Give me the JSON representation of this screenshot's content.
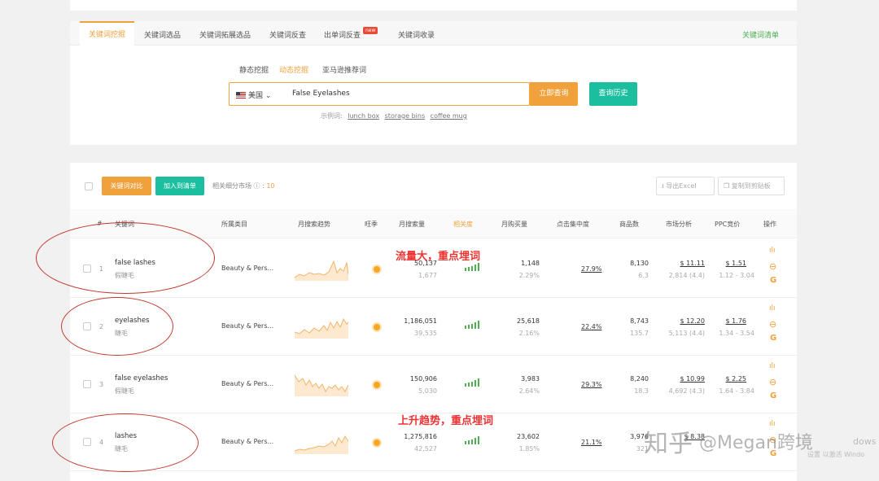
{
  "tabs": [
    "关键词挖掘",
    "关键词选品",
    "关键词拓展选品",
    "关键词反查",
    "出单词反查",
    "关键词收录"
  ],
  "tab_new_badge": "new",
  "tab_right": "关键词清单",
  "subtabs": [
    "静态挖掘",
    "动态挖掘",
    "亚马逊推荐词"
  ],
  "search": {
    "country": "美国",
    "value": "False Eyelashes",
    "query_btn": "立即查询",
    "history_btn": "查询历史"
  },
  "examples": {
    "label": "示例词:",
    "items": [
      "lunch box",
      "storage bins",
      "coffee mug"
    ]
  },
  "toolbar": {
    "compare_btn": "关键词对比",
    "add_btn": "加入到清单",
    "market_label": "相关细分市场",
    "market_count": "10",
    "export_btn": "导出Excel",
    "copy_btn": "复制到剪贴板"
  },
  "columns": [
    "#",
    "关键词",
    "所属类目",
    "月搜索趋势",
    "旺季",
    "月搜索量",
    "相关度",
    "月购买量",
    "点击集中度",
    "商品数",
    "市场分析",
    "PPC竞价",
    "操作"
  ],
  "rows": [
    {
      "idx": "1",
      "kw": "false lashes",
      "kw_cn": "假睫毛",
      "cat": "Beauty & Pers...",
      "search": "50,137",
      "search_sub": "1,677",
      "buy": "1,148",
      "buy_pct": "2.29%",
      "click": "27.9%",
      "goods": "8,130",
      "goods_sub": "6.3",
      "mkt": "$ 11.11",
      "mkt_sub": "2,814 (4.4)",
      "ppc": "$ 1.51",
      "ppc_sub": "1.12 - 3.04"
    },
    {
      "idx": "2",
      "kw": "eyelashes",
      "kw_cn": "睫毛",
      "cat": "Beauty & Pers...",
      "search": "1,186,051",
      "search_sub": "39,535",
      "buy": "25,618",
      "buy_pct": "2.16%",
      "click": "22.4%",
      "goods": "8,743",
      "goods_sub": "135.7",
      "mkt": "$ 12.20",
      "mkt_sub": "5,113 (4.4)",
      "ppc": "$ 1.76",
      "ppc_sub": "1.34 - 3.54"
    },
    {
      "idx": "3",
      "kw": "false eyelashes",
      "kw_cn": "假睫毛",
      "cat": "Beauty & Pers...",
      "search": "150,906",
      "search_sub": "5,030",
      "buy": "3,983",
      "buy_pct": "2.64%",
      "click": "29.3%",
      "goods": "8,240",
      "goods_sub": "18.3",
      "mkt": "$ 10.99",
      "mkt_sub": "4,692 (4.3)",
      "ppc": "$ 2.25",
      "ppc_sub": "1.64 - 3.84"
    },
    {
      "idx": "4",
      "kw": "lashes",
      "kw_cn": "睫毛",
      "cat": "Beauty & Pers...",
      "search": "1,275,816",
      "search_sub": "42,527",
      "buy": "23,602",
      "buy_pct": "1.85%",
      "click": "21.1%",
      "goods": "3,976",
      "goods_sub": "321",
      "mkt": "$ 8.38",
      "mkt_sub": "",
      "ppc": "",
      "ppc_sub": ""
    }
  ],
  "annotations": [
    "流量大，重点埋词",
    "上升趋势，重点埋词"
  ],
  "watermark": {
    "zhihu": "知乎",
    "account": "@Megan跨境",
    "side": "dows",
    "side2": "设置  以激活 Windo"
  },
  "colors": {
    "accent": "#f0a13b",
    "teal": "#1bbf9f",
    "annotation": "#e33333"
  }
}
